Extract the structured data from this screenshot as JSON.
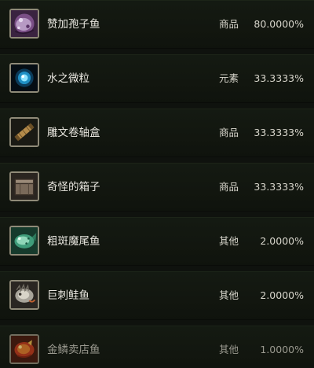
{
  "items": [
    {
      "name": "赞加孢子鱼",
      "category": "商品",
      "chance": "80.0000%",
      "icon": "zangar-spore-fish-icon"
    },
    {
      "name": "水之微粒",
      "category": "元素",
      "chance": "33.3333%",
      "icon": "mote-of-water-icon"
    },
    {
      "name": "雕文卷轴盒",
      "category": "商品",
      "chance": "33.3333%",
      "icon": "scroll-case-icon"
    },
    {
      "name": "奇怪的箱子",
      "category": "商品",
      "chance": "33.3333%",
      "icon": "curious-crate-icon"
    },
    {
      "name": "粗斑魔尾鱼",
      "category": "其他",
      "chance": "2.0000%",
      "icon": "spotted-feltail-icon"
    },
    {
      "name": "巨刺鲑鱼",
      "category": "其他",
      "chance": "2.0000%",
      "icon": "spiny-salmon-icon"
    },
    {
      "name": "金鳞卖店鱼",
      "category": "其他",
      "chance": "1.0000%",
      "icon": "golden-fish-icon"
    }
  ]
}
